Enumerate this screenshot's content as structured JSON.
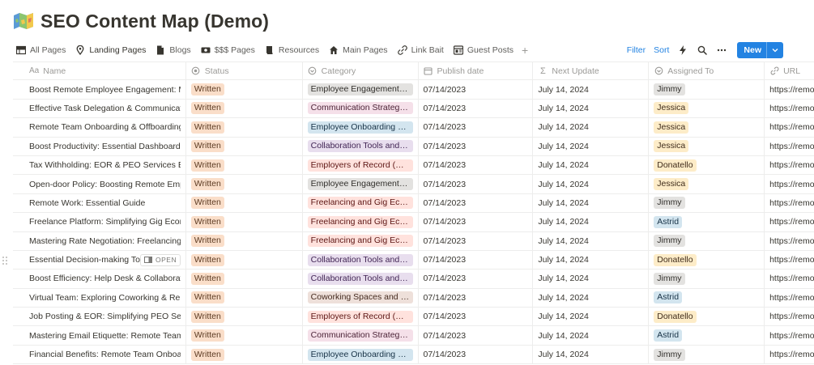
{
  "page": {
    "title": "SEO Content Map (Demo)",
    "icon": "map-icon"
  },
  "views": [
    {
      "label": "All Pages",
      "icon": "table-icon",
      "active": false
    },
    {
      "label": "Landing Pages",
      "icon": "location-pin-icon",
      "active": true
    },
    {
      "label": "Blogs",
      "icon": "document-icon",
      "active": false
    },
    {
      "label": "$$$ Pages",
      "icon": "money-icon",
      "active": false
    },
    {
      "label": "Resources",
      "icon": "book-icon",
      "active": false
    },
    {
      "label": "Main Pages",
      "icon": "home-icon",
      "active": false
    },
    {
      "label": "Link Bait",
      "icon": "link-icon",
      "active": false
    },
    {
      "label": "Guest Posts",
      "icon": "guest-icon",
      "active": false
    }
  ],
  "add_view_label": "+",
  "toolbar": {
    "filter_label": "Filter",
    "sort_label": "Sort",
    "new_label": "New"
  },
  "columns": {
    "name": "Name",
    "name_prefix": "Aa",
    "status": "Status",
    "category": "Category",
    "publish_date": "Publish date",
    "next_update": "Next Update",
    "next_update_prefix": "Σ",
    "assigned_to": "Assigned To",
    "url": "URL"
  },
  "open_badge_label": "OPEN",
  "rows": [
    {
      "name": "Boost Remote Employee Engagement: Ma",
      "status": "Written",
      "category": "Employee Engagement in...",
      "cat_color": "grey",
      "publish": "07/14/2023",
      "next": "July 14, 2024",
      "assigned": "Jimmy",
      "as_color": "grey",
      "url": "https://remo"
    },
    {
      "name": "Effective Task Delegation & Communicatic",
      "status": "Written",
      "category": "Communication Strategie...",
      "cat_color": "pink",
      "publish": "07/14/2023",
      "next": "July 14, 2024",
      "assigned": "Jessica",
      "as_color": "yellow",
      "url": "https://remo"
    },
    {
      "name": "Remote Team Onboarding & Offboarding:",
      "status": "Written",
      "category": "Employee Onboarding an...",
      "cat_color": "blue",
      "publish": "07/14/2023",
      "next": "July 14, 2024",
      "assigned": "Jessica",
      "as_color": "yellow",
      "url": "https://remo"
    },
    {
      "name": "Boost Productivity: Essential Dashboard To",
      "status": "Written",
      "category": "Collaboration Tools and S...",
      "cat_color": "purple",
      "publish": "07/14/2023",
      "next": "July 14, 2024",
      "assigned": "Jessica",
      "as_color": "yellow",
      "url": "https://remo"
    },
    {
      "name": "Tax Withholding: EOR & PEO Services Expl",
      "status": "Written",
      "category": "Employers of Record (EO...",
      "cat_color": "red",
      "publish": "07/14/2023",
      "next": "July 14, 2024",
      "assigned": "Donatello",
      "as_color": "yellow",
      "url": "https://remo"
    },
    {
      "name": "Open-door Policy: Boosting Remote Emplo",
      "status": "Written",
      "category": "Employee Engagement in...",
      "cat_color": "grey",
      "publish": "07/14/2023",
      "next": "July 14, 2024",
      "assigned": "Jessica",
      "as_color": "yellow",
      "url": "https://remo"
    },
    {
      "name": "Remote Work: Essential Guide",
      "status": "Written",
      "category": "Freelancing and Gig Econ...",
      "cat_color": "red",
      "publish": "07/14/2023",
      "next": "July 14, 2024",
      "assigned": "Jimmy",
      "as_color": "grey",
      "url": "https://remo"
    },
    {
      "name": "Freelance Platform: Simplifying Gig Econo",
      "status": "Written",
      "category": "Freelancing and Gig Econ...",
      "cat_color": "red",
      "publish": "07/14/2023",
      "next": "July 14, 2024",
      "assigned": "Astrid",
      "as_color": "blue",
      "url": "https://remo"
    },
    {
      "name": "Mastering Rate Negotiation: Freelancing In",
      "status": "Written",
      "category": "Freelancing and Gig Econ...",
      "cat_color": "red",
      "publish": "07/14/2023",
      "next": "July 14, 2024",
      "assigned": "Jimmy",
      "as_color": "grey",
      "url": "https://remo"
    },
    {
      "name": "Essential Decision-making Tools",
      "status": "Written",
      "category": "Collaboration Tools and S...",
      "cat_color": "purple",
      "publish": "07/14/2023",
      "next": "July 14, 2024",
      "assigned": "Donatello",
      "as_color": "yellow",
      "url": "https://remo",
      "hover": true
    },
    {
      "name": "Boost Efficiency: Help Desk & Collaboratio",
      "status": "Written",
      "category": "Collaboration Tools and S...",
      "cat_color": "purple",
      "publish": "07/14/2023",
      "next": "July 14, 2024",
      "assigned": "Jimmy",
      "as_color": "grey",
      "url": "https://remo"
    },
    {
      "name": "Virtual Team: Exploring Coworking & Rem",
      "status": "Written",
      "category": "Coworking Spaces and Re...",
      "cat_color": "brown",
      "publish": "07/14/2023",
      "next": "July 14, 2024",
      "assigned": "Astrid",
      "as_color": "blue",
      "url": "https://remo"
    },
    {
      "name": "Job Posting & EOR: Simplifying PEO Servic",
      "status": "Written",
      "category": "Employers of Record (EO...",
      "cat_color": "red",
      "publish": "07/14/2023",
      "next": "July 14, 2024",
      "assigned": "Donatello",
      "as_color": "yellow",
      "url": "https://remo"
    },
    {
      "name": "Mastering Email Etiquette: Remote Team C",
      "status": "Written",
      "category": "Communication Strategie...",
      "cat_color": "pink",
      "publish": "07/14/2023",
      "next": "July 14, 2024",
      "assigned": "Astrid",
      "as_color": "blue",
      "url": "https://remo"
    },
    {
      "name": "Financial Benefits: Remote Team Onboardi",
      "status": "Written",
      "category": "Employee Onboarding an...",
      "cat_color": "blue",
      "publish": "07/14/2023",
      "next": "July 14, 2024",
      "assigned": "Jimmy",
      "as_color": "grey",
      "url": "https://remo"
    }
  ]
}
